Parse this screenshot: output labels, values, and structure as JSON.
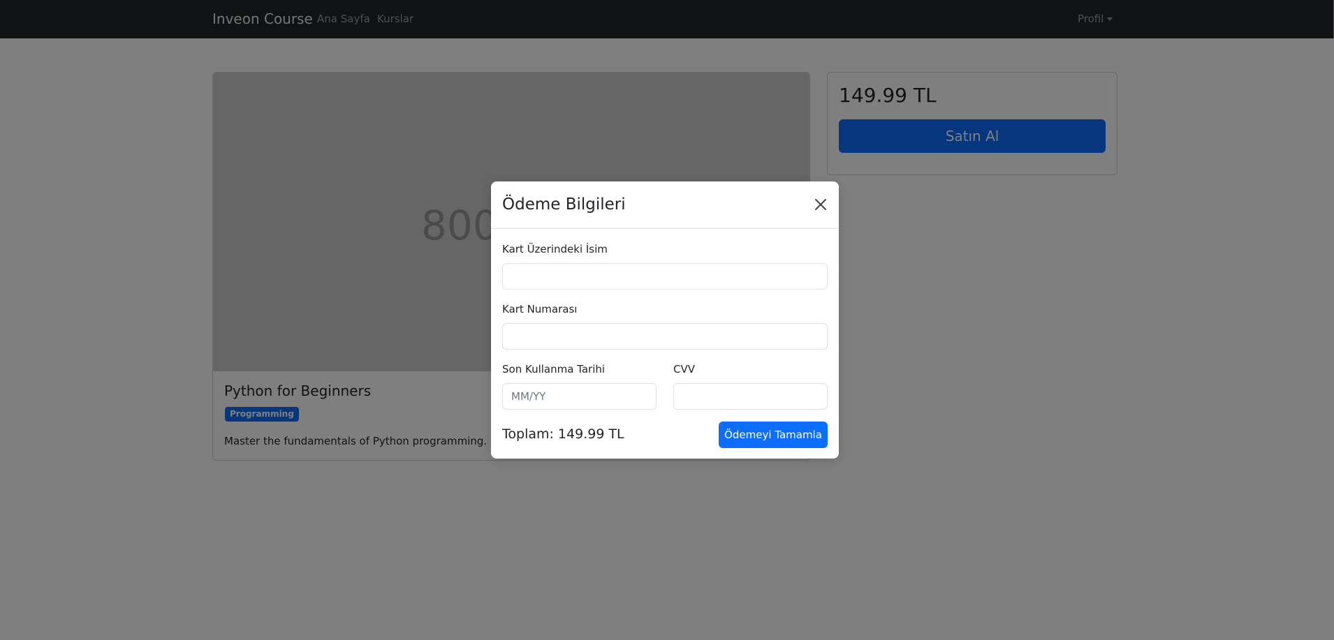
{
  "navbar": {
    "brand": "Inveon Course",
    "links": [
      "Ana Sayfa",
      "Kurslar"
    ],
    "profile": "Profil"
  },
  "course": {
    "image_placeholder": "800",
    "title": "Python for Beginners",
    "badge": "Programming",
    "description": "Master the fundamentals of Python programming."
  },
  "purchase": {
    "price": "149.99 TL",
    "buy_label": "Satın Al"
  },
  "modal": {
    "title": "Ödeme Bilgileri",
    "fields": {
      "card_name_label": "Kart Üzerindeki İsim",
      "card_name_value": "",
      "card_number_label": "Kart Numarası",
      "card_number_value": "",
      "expiry_label": "Son Kullanma Tarihi",
      "expiry_placeholder": "MM/YY",
      "cvv_label": "CVV",
      "cvv_value": ""
    },
    "total": "Toplam: 149.99 TL",
    "submit_label": "Ödemeyi Tamamla"
  },
  "colors": {
    "navbar": "#212529",
    "primary": "#0d6efd",
    "backdrop": "rgba(0,0,0,0.5)"
  }
}
